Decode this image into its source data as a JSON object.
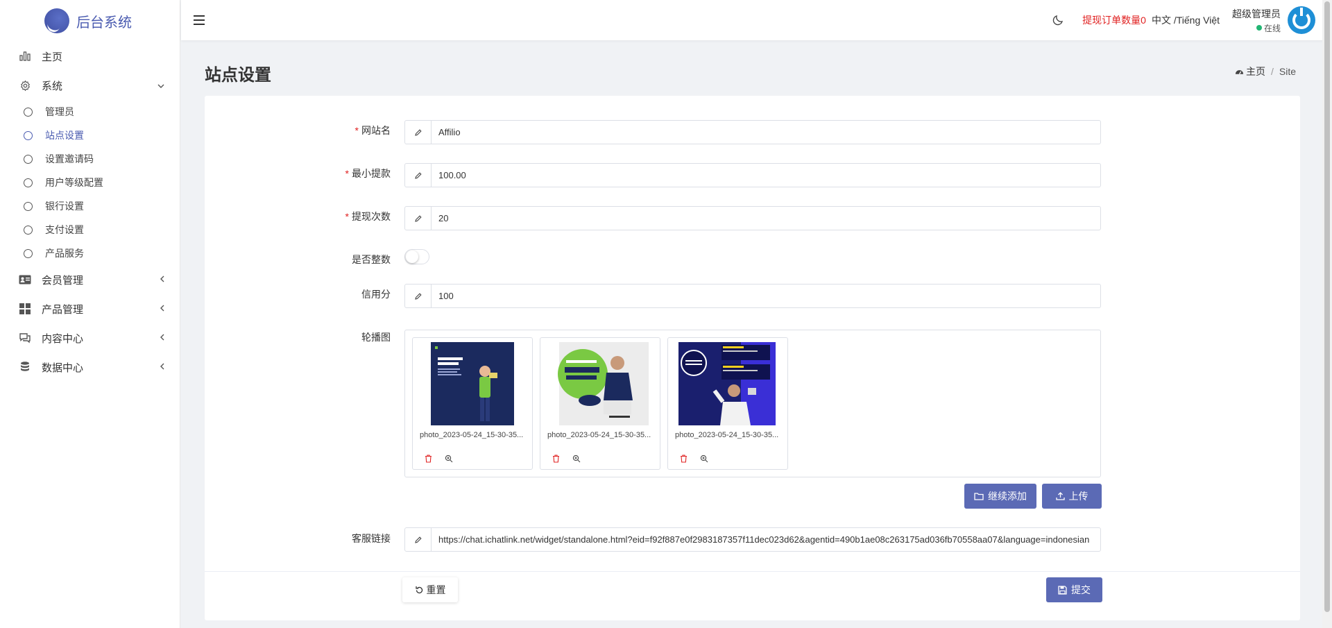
{
  "app": {
    "title": "后台系统"
  },
  "sidebar": {
    "items": [
      {
        "label": "主页",
        "icon": "bar-chart-icon"
      },
      {
        "label": "系统",
        "icon": "gear-icon",
        "expanded": true,
        "children": [
          {
            "label": "管理员"
          },
          {
            "label": "站点设置",
            "active": true
          },
          {
            "label": "设置邀请码"
          },
          {
            "label": "用户等级配置"
          },
          {
            "label": "银行设置"
          },
          {
            "label": "支付设置"
          },
          {
            "label": "产品服务"
          }
        ]
      },
      {
        "label": "会员管理",
        "icon": "id-card-icon"
      },
      {
        "label": "产品管理",
        "icon": "grid-icon"
      },
      {
        "label": "内容中心",
        "icon": "chat-icon"
      },
      {
        "label": "数据中心",
        "icon": "database-icon"
      }
    ]
  },
  "topbar": {
    "orders_label": "提现订单数量0",
    "language": "中文 /Tiếng Việt",
    "user_name": "超级管理员",
    "user_status": "在线"
  },
  "page": {
    "title": "站点设置",
    "breadcrumb": {
      "home": "主页",
      "current": "Site"
    }
  },
  "form": {
    "site_name": {
      "label": "网站名",
      "value": "Affilio",
      "required": true
    },
    "min_withdraw": {
      "label": "最小提款",
      "value": "100.00",
      "required": true
    },
    "withdraw_count": {
      "label": "提现次数",
      "value": "20",
      "required": true
    },
    "integer_only": {
      "label": "是否整数",
      "on": false
    },
    "credit": {
      "label": "信用分",
      "value": "100"
    },
    "carousel": {
      "label": "轮播图",
      "files": [
        {
          "name": "photo_2023-05-24_15-30-35..."
        },
        {
          "name": "photo_2023-05-24_15-30-35..."
        },
        {
          "name": "photo_2023-05-24_15-30-35..."
        }
      ],
      "add_more_label": "继续添加",
      "upload_label": "上传"
    },
    "service_link": {
      "label": "客服链接",
      "value": "https://chat.ichatlink.net/widget/standalone.html?eid=f92f887e0f2983187357f11dec023d62&agentid=490b1ae08c263175ad036fb70558aa07&language=indonesian"
    },
    "reset_label": "重置",
    "submit_label": "提交"
  },
  "colors": {
    "accent": "#5b6ab5",
    "danger": "#e02020",
    "online": "#22b573"
  }
}
